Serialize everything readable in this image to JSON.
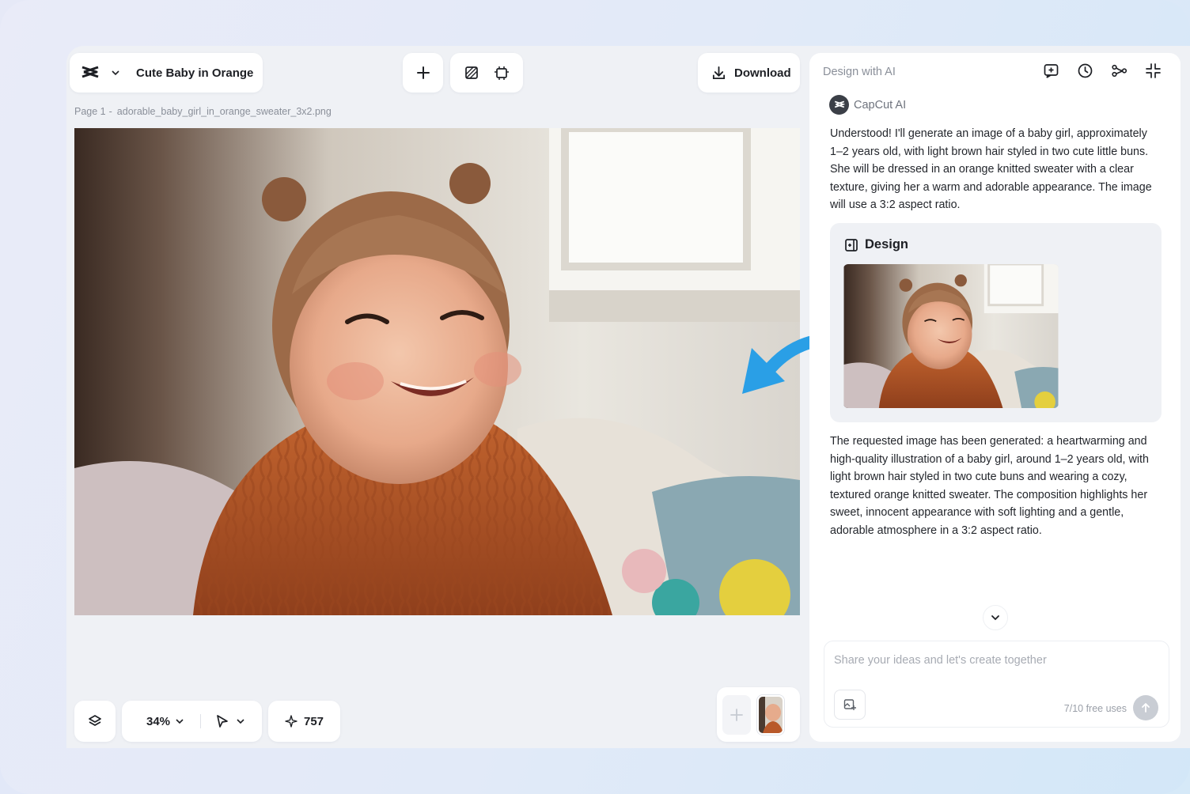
{
  "header": {
    "doc_title": "Cute Baby in Orange",
    "download_label": "Download"
  },
  "page": {
    "label": "Page 1",
    "separator": "-",
    "filename": "adorable_baby_girl_in_orange_sweater_3x2.png"
  },
  "bottom_bar": {
    "zoom": "34%",
    "credits": "757"
  },
  "panel": {
    "title": "Design with AI",
    "ai_name": "CapCut AI",
    "message_1": "Understood! I'll generate an image of a baby girl, approximately 1–2 years old, with light brown hair styled in two cute little buns. She will be dressed in an orange knitted sweater with a clear texture, giving her a warm and adorable appearance. The image will use a 3:2 aspect ratio.",
    "design_card_title": "Design",
    "message_2": "The requested image has been generated: a heartwarming and high-quality illustration of a baby girl, around 1–2 years old, with light brown hair styled in two cute buns and wearing a cozy, textured orange knitted sweater. The composition highlights her sweet, innocent appearance with soft lighting and a gentle, adorable atmosphere in a 3:2 aspect ratio.",
    "composer_placeholder": "Share your ideas and let's create together",
    "free_uses": "7/10 free uses"
  },
  "colors": {
    "accent_arrow": "#2a9fe6",
    "sweater": "#b8592a",
    "panel_bg": "#ffffff",
    "app_bg": "#eff1f5"
  },
  "icons": [
    "capcut-logo-icon",
    "chevron-down-icon",
    "plus-icon",
    "background-remove-icon",
    "resize-icon",
    "download-icon",
    "new-chat-icon",
    "history-icon",
    "share-icon",
    "collapse-icon",
    "layers-icon",
    "pointer-icon",
    "sparkle-icon",
    "image-upload-icon",
    "send-arrow-icon",
    "design-icon"
  ]
}
